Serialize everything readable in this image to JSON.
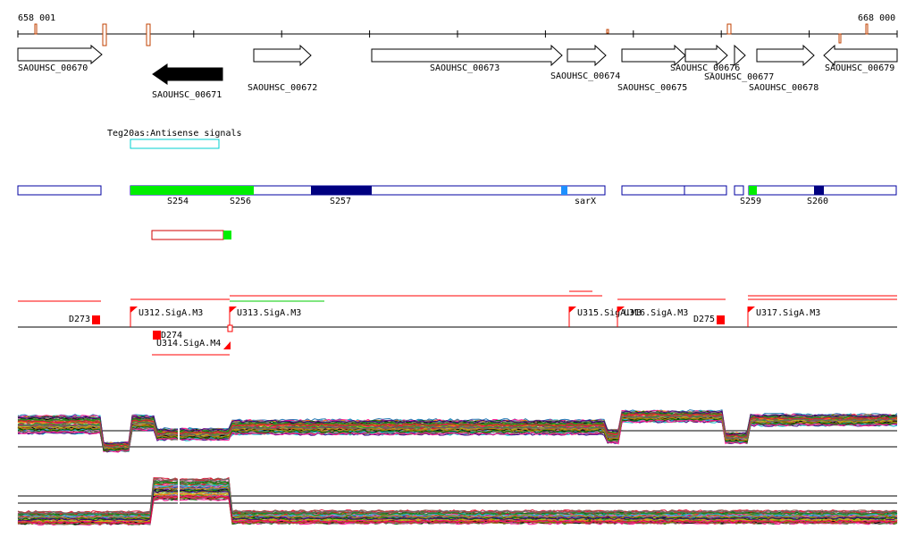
{
  "axis": {
    "start": "658 001",
    "end": "668 000"
  },
  "genes": [
    {
      "id": "SAOUHSC_00670",
      "strand": "+"
    },
    {
      "id": "SAOUHSC_00671",
      "strand": "-",
      "highlighted": true
    },
    {
      "id": "SAOUHSC_00672",
      "strand": "+"
    },
    {
      "id": "SAOUHSC_00673",
      "strand": "+"
    },
    {
      "id": "SAOUHSC_00674",
      "strand": "+"
    },
    {
      "id": "SAOUHSC_00675",
      "strand": "+"
    },
    {
      "id": "SAOUHSC_00676",
      "strand": "+"
    },
    {
      "id": "SAOUHSC_00677",
      "strand": "+"
    },
    {
      "id": "SAOUHSC_00678",
      "strand": "+"
    },
    {
      "id": "SAOUHSC_00679",
      "strand": "+"
    }
  ],
  "antisense": {
    "label": "Teg20as:Antisense signals"
  },
  "segments": [
    "S254",
    "S256",
    "S257",
    "sarX",
    "S259",
    "S260"
  ],
  "promoters": [
    {
      "label": "D273"
    },
    {
      "label": "U312.SigA.M3"
    },
    {
      "label": "U313.SigA.M3"
    },
    {
      "label": "D274"
    },
    {
      "label": "U314.SigA.M4"
    },
    {
      "label": "U315.SigA.M3"
    },
    {
      "label": "U316.SigA.M3"
    },
    {
      "label": "D275"
    },
    {
      "label": "U317.SigA.M3"
    }
  ],
  "colors": {
    "gene_outline": "#000000",
    "gene_highlight": "#000000",
    "antisense": "#00d0d0",
    "segment_outline": "#0000a0",
    "segment_green": "#00ee00",
    "segment_navy": "#000080",
    "segment_light_blue": "#1e90ff",
    "promoter": "#ff0000",
    "tick_marks": "#c04000"
  },
  "expression_tracks": {
    "panels": 2,
    "profile_count": 60
  }
}
